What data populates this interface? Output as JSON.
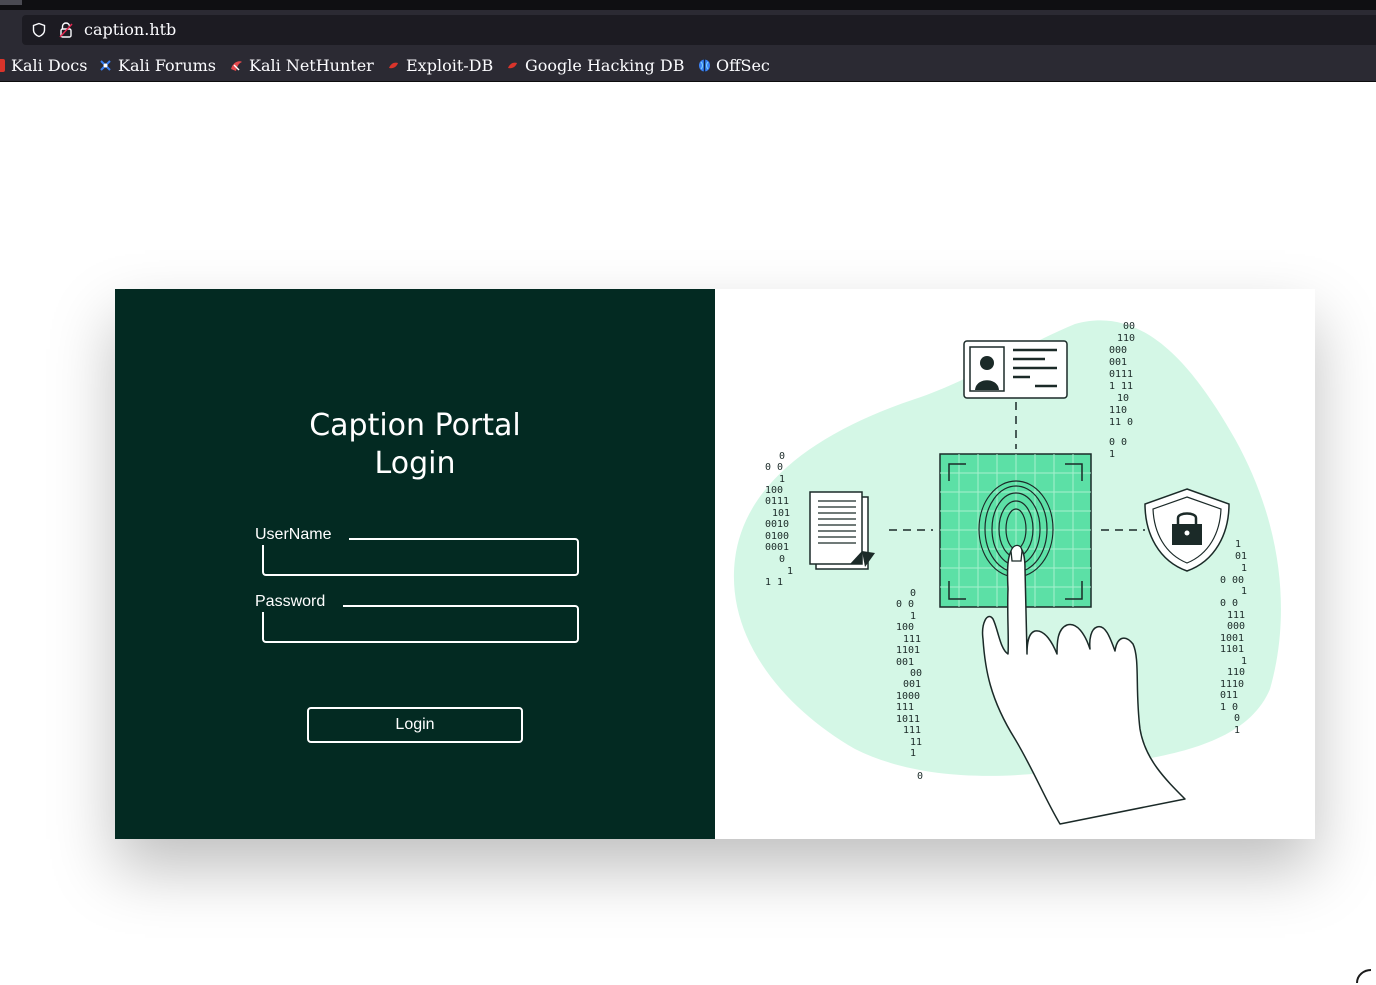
{
  "browser": {
    "url": "caption.htb",
    "bookmarks": [
      {
        "label": "Kali Docs",
        "icon": "kali-docs-icon"
      },
      {
        "label": "Kali Forums",
        "icon": "kali-forums-icon"
      },
      {
        "label": "Kali NetHunter",
        "icon": "kali-nethunter-icon"
      },
      {
        "label": "Exploit-DB",
        "icon": "exploit-db-icon"
      },
      {
        "label": "Google Hacking DB",
        "icon": "google-hacking-db-icon"
      },
      {
        "label": "OffSec",
        "icon": "offsec-icon"
      }
    ]
  },
  "login": {
    "title_line1": "Caption Portal",
    "title_line2": "Login",
    "username_label": "UserName",
    "username_value": "",
    "password_label": "Password",
    "password_value": "",
    "submit_label": "Login"
  },
  "colors": {
    "panel_bg": "#032a22",
    "accent_green": "#5ce0a6",
    "blob_green": "#d4f7e6"
  }
}
